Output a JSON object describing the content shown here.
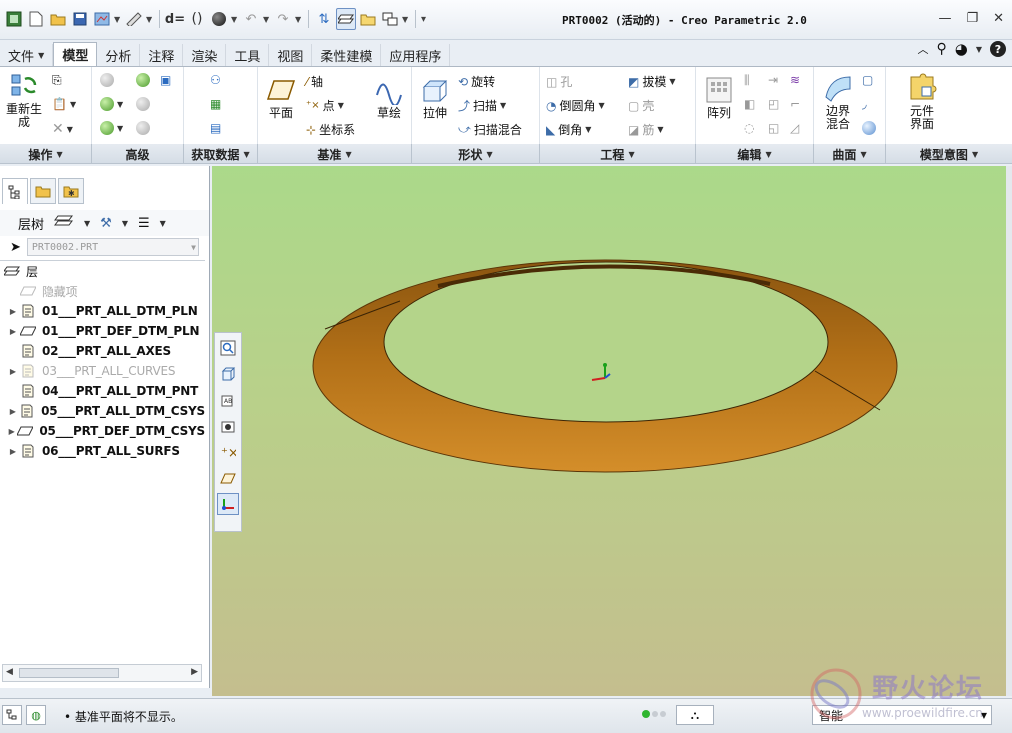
{
  "window": {
    "title": "PRT0002 (活动的) - Creo Parametric 2.0"
  },
  "tabs": [
    "文件",
    "模型",
    "分析",
    "注释",
    "渲染",
    "工具",
    "视图",
    "柔性建模",
    "应用程序"
  ],
  "active_tab": "模型",
  "ribbon": {
    "operations": {
      "regenerate": "重新生\n成"
    },
    "datum": {
      "plane": "平面",
      "axis": "轴",
      "point": "点",
      "csys": "坐标系",
      "sketch": "草绘"
    },
    "shapes": {
      "extrude": "拉伸",
      "revolve": "旋转",
      "sweep": "扫描",
      "swept_blend": "扫描混合"
    },
    "engineering": {
      "hole": "孔",
      "round": "倒圆角",
      "chamfer": "倒角",
      "draft": "拔模",
      "shell": "壳",
      "rib": "筋"
    },
    "editing": {
      "pattern": "阵列"
    },
    "surfaces": {
      "boundary_blend": "边界\n混合"
    },
    "model_intent": {
      "component_interface": "元件\n界面"
    }
  },
  "group_labels": [
    {
      "label": "操作"
    },
    {
      "label": "高级"
    },
    {
      "label": "获取数据"
    },
    {
      "label": "基准"
    },
    {
      "label": "形状"
    },
    {
      "label": "工程"
    },
    {
      "label": "编辑"
    },
    {
      "label": "曲面"
    },
    {
      "label": "模型意图"
    }
  ],
  "panel": {
    "layer_tree_label": "层树",
    "selector_value": "PRT0002.PRT",
    "root_label": "层",
    "items": [
      {
        "label": "隐藏项",
        "state": "gray",
        "expandable": false
      },
      {
        "label": "01___PRT_ALL_DTM_PLN",
        "state": "normal",
        "expandable": true
      },
      {
        "label": "01___PRT_DEF_DTM_PLN",
        "state": "normal",
        "expandable": true
      },
      {
        "label": "02___PRT_ALL_AXES",
        "state": "normal",
        "expandable": false
      },
      {
        "label": "03___PRT_ALL_CURVES",
        "state": "gray",
        "expandable": true
      },
      {
        "label": "04___PRT_ALL_DTM_PNT",
        "state": "normal",
        "expandable": false
      },
      {
        "label": "05___PRT_ALL_DTM_CSYS",
        "state": "normal",
        "expandable": true
      },
      {
        "label": "05___PRT_DEF_DTM_CSYS",
        "state": "normal",
        "expandable": true
      },
      {
        "label": "06___PRT_ALL_SURFS",
        "state": "normal",
        "expandable": true
      }
    ]
  },
  "statusbar": {
    "message": "基准平面将不显示。",
    "filter_value": "智能"
  },
  "watermark": {
    "title": "野火论坛",
    "url": "www.proewildfire.cn"
  },
  "colors": {
    "model_orange": "#c07a1c",
    "model_dark": "#7a4a0f",
    "viewport_top": "#abd98a",
    "viewport_bottom": "#c4be8e"
  }
}
